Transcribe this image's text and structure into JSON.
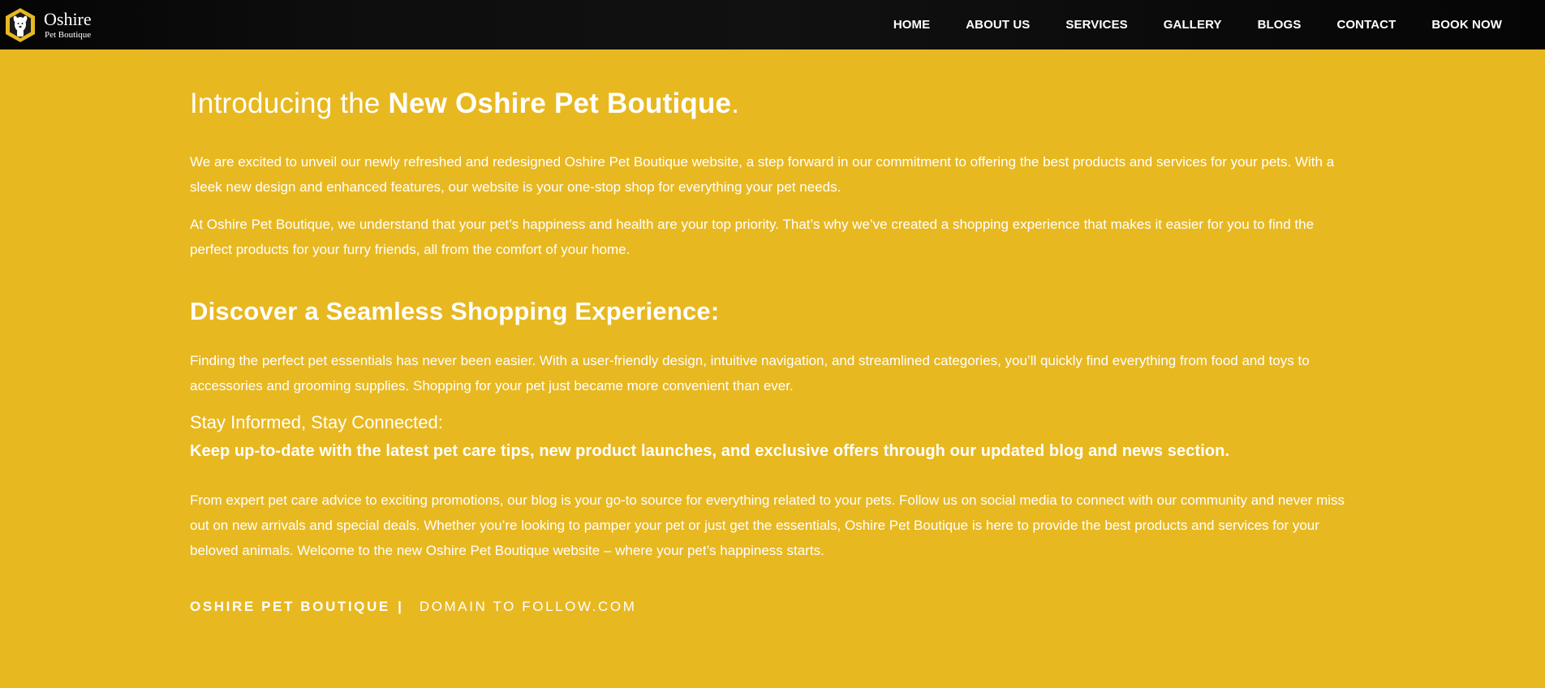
{
  "brand": {
    "name": "Oshire",
    "subtitle": "Pet Boutique"
  },
  "nav": {
    "items": [
      {
        "label": "HOME"
      },
      {
        "label": "ABOUT US"
      },
      {
        "label": "SERVICES"
      },
      {
        "label": "GALLERY"
      },
      {
        "label": "BLOGS"
      },
      {
        "label": "CONTACT"
      },
      {
        "label": "BOOK NOW"
      }
    ]
  },
  "article": {
    "title_prefix": "Introducing the ",
    "title_bold": "New Oshire Pet Boutique",
    "title_suffix": ".",
    "para1": "We are excited to unveil our newly refreshed and redesigned Oshire Pet Boutique website, a step forward in our commitment to offering the best products and services for your pets. With a sleek new design and enhanced features, our website is your one-stop shop for everything your pet needs.",
    "para2": "At Oshire Pet Boutique, we understand that your pet’s happiness and health are your top priority. That’s why we’ve created a shopping experience that makes it easier for you to find the perfect products for your furry friends, all from the comfort of your home.",
    "heading2": "Discover a Seamless Shopping Experience:",
    "para3": "Finding the perfect pet essentials has never been easier. With a user-friendly design, intuitive navigation, and streamlined categories, you’ll quickly find everything from food and toys to accessories and grooming supplies. Shopping for your pet just became more convenient than ever.",
    "heading3": "Stay Informed, Stay Connected:",
    "heading4": "Keep up-to-date with the latest pet care tips, new product launches, and exclusive offers through our updated blog and news section.",
    "para4": "From expert pet care advice to exciting promotions, our blog is your go-to source for everything related to your pets. Follow us on social media to connect with our community and never miss out on new arrivals and special deals. Whether you’re looking to pamper your pet or just get the essentials, Oshire Pet Boutique is here to provide the best products and services for your beloved animals. Welcome to the new Oshire Pet Boutique website – where your pet’s happiness starts.",
    "footer_brand": "OSHIRE PET BOUTIQUE",
    "footer_sep": "|",
    "footer_domain": "DOMAIN TO FOLLOW.COM"
  },
  "colors": {
    "background": "#E8B821",
    "header": "#0b0b0b",
    "text": "#ffffff"
  },
  "icons": {
    "logo": "dog-badge-icon"
  }
}
